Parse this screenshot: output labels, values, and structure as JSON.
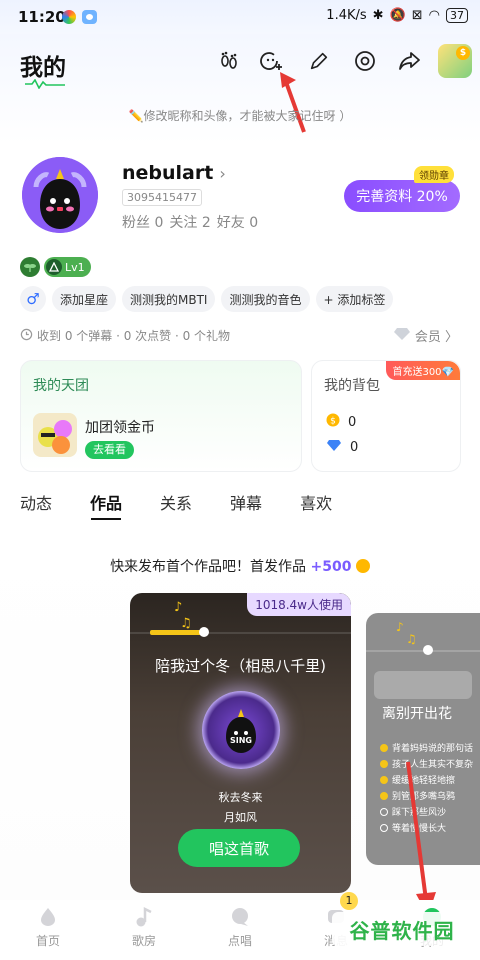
{
  "status": {
    "time": "11:20",
    "speed": "1.4K/s",
    "battery": "37"
  },
  "header": {
    "title": "我的",
    "hint": "✏️修改昵称和头像，才能被大家记住呀 ）"
  },
  "profile": {
    "username": "nebulart",
    "chevron": "›",
    "uid": "3095415477",
    "fans_label": "粉丝",
    "fans": "0",
    "following_label": "关注",
    "following": "2",
    "friends_label": "好友",
    "friends": "0",
    "complete_btn": "完善资料 20%",
    "reward_tag": "领勋章",
    "level": "Lv1"
  },
  "tags": {
    "gender": "♂",
    "items": [
      "添加星座",
      "测测我的MBTI",
      "测测我的音色",
      "+ 添加标签"
    ]
  },
  "received": {
    "text": "收到 0 个弹幕 · 0 次点赞 · 0 个礼物"
  },
  "member": {
    "label": "会员 〉"
  },
  "team_card": {
    "title": "我的天团",
    "name": "加团领金币",
    "go": "去看看"
  },
  "bag_card": {
    "title": "我的背包",
    "promo": "首充送300💎",
    "coins": "0",
    "diamonds": "0"
  },
  "tabs": [
    "动态",
    "作品",
    "关系",
    "弹幕",
    "喜欢"
  ],
  "works": {
    "hint_prefix": "快来发布首个作品吧！首发作品 ",
    "hint_plus": "+500",
    "card1": {
      "users": "1018.4w人使用",
      "title": "陪我过个冬（相思八千里)",
      "lyric1": "秋去冬来",
      "lyric2": "月如风",
      "btn": "唱这首歌"
    },
    "card2": {
      "title": "离别开出花",
      "todos": [
        "背着妈妈说的那句话",
        "孩子人生其实不复杂",
        "缓缓地轻轻地擦",
        "别管那多嘴乌鸦",
        "踩下那些风沙",
        "等着慢慢长大"
      ]
    }
  },
  "nav": [
    {
      "label": "首页",
      "icon": "home-icon"
    },
    {
      "label": "歌房",
      "icon": "music-note-icon"
    },
    {
      "label": "点唱",
      "icon": "chat-bubble-icon"
    },
    {
      "label": "消息",
      "icon": "message-icon",
      "badge": "1"
    },
    {
      "label": "我的",
      "icon": "profile-icon"
    }
  ],
  "watermark": "谷普软件园"
}
